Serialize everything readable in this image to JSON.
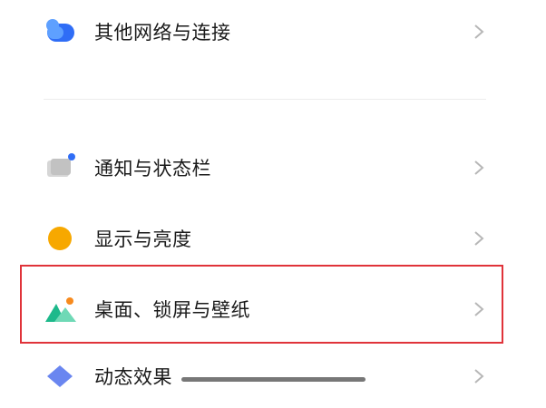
{
  "settings": {
    "items": [
      {
        "label": "其他网络与连接",
        "icon": "cloud-icon"
      },
      {
        "label": "通知与状态栏",
        "icon": "notification-icon"
      },
      {
        "label": "显示与亮度",
        "icon": "brightness-icon"
      },
      {
        "label": "桌面、锁屏与壁纸",
        "icon": "wallpaper-icon"
      },
      {
        "label": "动态效果",
        "icon": "animation-icon"
      }
    ]
  },
  "colors": {
    "highlight": "#e0333a",
    "cloud": "#2f6df6",
    "brightness": "#f7a800",
    "wallpaper": "#1db98b"
  }
}
